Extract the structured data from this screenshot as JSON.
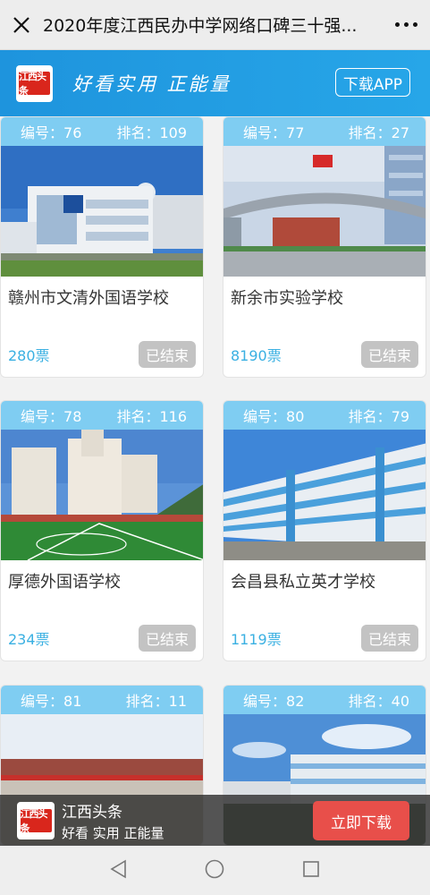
{
  "titlebar": {
    "title": "2020年度江西民办中学网络口碑三十强..."
  },
  "banner": {
    "logo_text": "江西头条",
    "slogan": "好看实用 正能量",
    "download_label": "下载APP"
  },
  "labels": {
    "id_prefix": "编号：",
    "rank_prefix": "排名："
  },
  "cards": [
    {
      "id": "76",
      "rank": "109",
      "name": "赣州市文清外国语学校",
      "votes": "280票",
      "status": "已结束"
    },
    {
      "id": "77",
      "rank": "27",
      "name": "新余市实验学校",
      "votes": "8190票",
      "status": "已结束"
    },
    {
      "id": "78",
      "rank": "116",
      "name": "厚德外国语学校",
      "votes": "234票",
      "status": "已结束"
    },
    {
      "id": "80",
      "rank": "79",
      "name": "会昌县私立英才学校",
      "votes": "1119票",
      "status": "已结束"
    },
    {
      "id": "81",
      "rank": "11",
      "name": "",
      "votes": "",
      "status": ""
    },
    {
      "id": "82",
      "rank": "40",
      "name": "",
      "votes": "",
      "status": ""
    }
  ],
  "dlbar": {
    "logo_text": "江西头条",
    "app_name": "江西头条",
    "tagline": "好看 实用 正能量",
    "button": "立即下载"
  },
  "colors": {
    "banner_blue": "#1e94dd",
    "card_head": "#7fcdf2",
    "vote_blue": "#3ab0e2",
    "download_red": "#e84f4a"
  },
  "icons": [
    "close-icon",
    "more-icon",
    "back-nav-icon",
    "home-nav-icon",
    "recents-nav-icon"
  ]
}
